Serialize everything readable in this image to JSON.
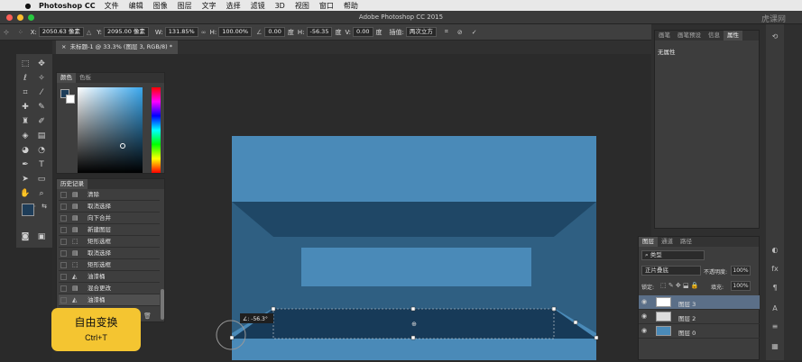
{
  "menubar": {
    "app_name": "Photoshop CC",
    "items": [
      "文件",
      "编辑",
      "图像",
      "图层",
      "文字",
      "选择",
      "滤镜",
      "3D",
      "视图",
      "窗口",
      "帮助"
    ]
  },
  "window": {
    "title": "Adobe Photoshop CC 2015",
    "watermark": "虎课网"
  },
  "options_bar": {
    "x_label": "X:",
    "x_value": "2050.63 像素",
    "y_label": "Y:",
    "y_value": "2095.00 像素",
    "w_label": "W:",
    "w_value": "131.85%",
    "h_label": "H:",
    "h_value": "100.00%",
    "angle_value": "0.00",
    "angle_unit": "度",
    "hskew_label": "H:",
    "hskew_value": "-56.35",
    "hskew_unit": "度",
    "vskew_label": "V:",
    "vskew_value": "0.00",
    "vskew_unit": "度",
    "interp_label": "插值:",
    "interp_value": "两次立方"
  },
  "document": {
    "tab_label": "未标题-1 @ 33.3% (图层 3, RGB/8) *"
  },
  "color_panel": {
    "tabs": [
      "颜色",
      "色板"
    ],
    "foreground": "#1e3d59",
    "background": "#ffffff"
  },
  "history_panel": {
    "tab": "历史记录",
    "items": [
      "清除",
      "取消选择",
      "向下合并",
      "新建图层",
      "矩形选框",
      "取消选择",
      "矩形选框",
      "油漆桶",
      "混合更改",
      "油漆桶"
    ]
  },
  "properties_panel": {
    "tabs": [
      "画笔",
      "画笔预设",
      "信息",
      "属性"
    ],
    "content": "无属性"
  },
  "layers_panel": {
    "tabs": [
      "图层",
      "通道",
      "路径"
    ],
    "filter": "类型",
    "blend_mode": "正片叠底",
    "opacity_label": "不透明度:",
    "opacity_value": "100%",
    "lock_label": "锁定:",
    "fill_label": "填充:",
    "fill_value": "100%",
    "layers": [
      {
        "name": "图层 3",
        "selected": true
      },
      {
        "name": "图层 2",
        "selected": false
      },
      {
        "name": "图层 0",
        "selected": false
      }
    ]
  },
  "canvas": {
    "angle_tooltip": "∠: -56.3°",
    "colors": {
      "light": "#4a8ab8",
      "mid": "#2f5f82",
      "dark": "#1f4766",
      "darkest": "#173a58"
    }
  },
  "hint_badge": {
    "title": "自由变换",
    "shortcut": "Ctrl+T"
  }
}
